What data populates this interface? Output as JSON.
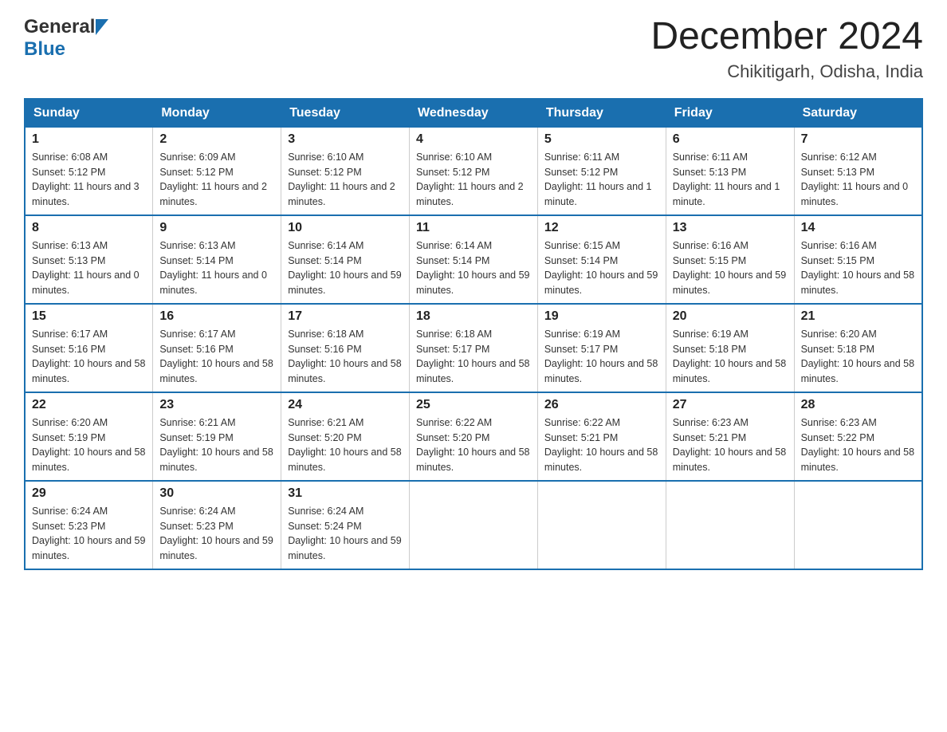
{
  "header": {
    "logo_general": "General",
    "logo_blue": "Blue",
    "month_title": "December 2024",
    "subtitle": "Chikitigarh, Odisha, India"
  },
  "days_of_week": [
    "Sunday",
    "Monday",
    "Tuesday",
    "Wednesday",
    "Thursday",
    "Friday",
    "Saturday"
  ],
  "weeks": [
    [
      {
        "day": "1",
        "sunrise": "6:08 AM",
        "sunset": "5:12 PM",
        "daylight": "11 hours and 3 minutes."
      },
      {
        "day": "2",
        "sunrise": "6:09 AM",
        "sunset": "5:12 PM",
        "daylight": "11 hours and 2 minutes."
      },
      {
        "day": "3",
        "sunrise": "6:10 AM",
        "sunset": "5:12 PM",
        "daylight": "11 hours and 2 minutes."
      },
      {
        "day": "4",
        "sunrise": "6:10 AM",
        "sunset": "5:12 PM",
        "daylight": "11 hours and 2 minutes."
      },
      {
        "day": "5",
        "sunrise": "6:11 AM",
        "sunset": "5:12 PM",
        "daylight": "11 hours and 1 minute."
      },
      {
        "day": "6",
        "sunrise": "6:11 AM",
        "sunset": "5:13 PM",
        "daylight": "11 hours and 1 minute."
      },
      {
        "day": "7",
        "sunrise": "6:12 AM",
        "sunset": "5:13 PM",
        "daylight": "11 hours and 0 minutes."
      }
    ],
    [
      {
        "day": "8",
        "sunrise": "6:13 AM",
        "sunset": "5:13 PM",
        "daylight": "11 hours and 0 minutes."
      },
      {
        "day": "9",
        "sunrise": "6:13 AM",
        "sunset": "5:14 PM",
        "daylight": "11 hours and 0 minutes."
      },
      {
        "day": "10",
        "sunrise": "6:14 AM",
        "sunset": "5:14 PM",
        "daylight": "10 hours and 59 minutes."
      },
      {
        "day": "11",
        "sunrise": "6:14 AM",
        "sunset": "5:14 PM",
        "daylight": "10 hours and 59 minutes."
      },
      {
        "day": "12",
        "sunrise": "6:15 AM",
        "sunset": "5:14 PM",
        "daylight": "10 hours and 59 minutes."
      },
      {
        "day": "13",
        "sunrise": "6:16 AM",
        "sunset": "5:15 PM",
        "daylight": "10 hours and 59 minutes."
      },
      {
        "day": "14",
        "sunrise": "6:16 AM",
        "sunset": "5:15 PM",
        "daylight": "10 hours and 58 minutes."
      }
    ],
    [
      {
        "day": "15",
        "sunrise": "6:17 AM",
        "sunset": "5:16 PM",
        "daylight": "10 hours and 58 minutes."
      },
      {
        "day": "16",
        "sunrise": "6:17 AM",
        "sunset": "5:16 PM",
        "daylight": "10 hours and 58 minutes."
      },
      {
        "day": "17",
        "sunrise": "6:18 AM",
        "sunset": "5:16 PM",
        "daylight": "10 hours and 58 minutes."
      },
      {
        "day": "18",
        "sunrise": "6:18 AM",
        "sunset": "5:17 PM",
        "daylight": "10 hours and 58 minutes."
      },
      {
        "day": "19",
        "sunrise": "6:19 AM",
        "sunset": "5:17 PM",
        "daylight": "10 hours and 58 minutes."
      },
      {
        "day": "20",
        "sunrise": "6:19 AM",
        "sunset": "5:18 PM",
        "daylight": "10 hours and 58 minutes."
      },
      {
        "day": "21",
        "sunrise": "6:20 AM",
        "sunset": "5:18 PM",
        "daylight": "10 hours and 58 minutes."
      }
    ],
    [
      {
        "day": "22",
        "sunrise": "6:20 AM",
        "sunset": "5:19 PM",
        "daylight": "10 hours and 58 minutes."
      },
      {
        "day": "23",
        "sunrise": "6:21 AM",
        "sunset": "5:19 PM",
        "daylight": "10 hours and 58 minutes."
      },
      {
        "day": "24",
        "sunrise": "6:21 AM",
        "sunset": "5:20 PM",
        "daylight": "10 hours and 58 minutes."
      },
      {
        "day": "25",
        "sunrise": "6:22 AM",
        "sunset": "5:20 PM",
        "daylight": "10 hours and 58 minutes."
      },
      {
        "day": "26",
        "sunrise": "6:22 AM",
        "sunset": "5:21 PM",
        "daylight": "10 hours and 58 minutes."
      },
      {
        "day": "27",
        "sunrise": "6:23 AM",
        "sunset": "5:21 PM",
        "daylight": "10 hours and 58 minutes."
      },
      {
        "day": "28",
        "sunrise": "6:23 AM",
        "sunset": "5:22 PM",
        "daylight": "10 hours and 58 minutes."
      }
    ],
    [
      {
        "day": "29",
        "sunrise": "6:24 AM",
        "sunset": "5:23 PM",
        "daylight": "10 hours and 59 minutes."
      },
      {
        "day": "30",
        "sunrise": "6:24 AM",
        "sunset": "5:23 PM",
        "daylight": "10 hours and 59 minutes."
      },
      {
        "day": "31",
        "sunrise": "6:24 AM",
        "sunset": "5:24 PM",
        "daylight": "10 hours and 59 minutes."
      },
      null,
      null,
      null,
      null
    ]
  ],
  "labels": {
    "sunrise": "Sunrise:",
    "sunset": "Sunset:",
    "daylight": "Daylight:"
  }
}
